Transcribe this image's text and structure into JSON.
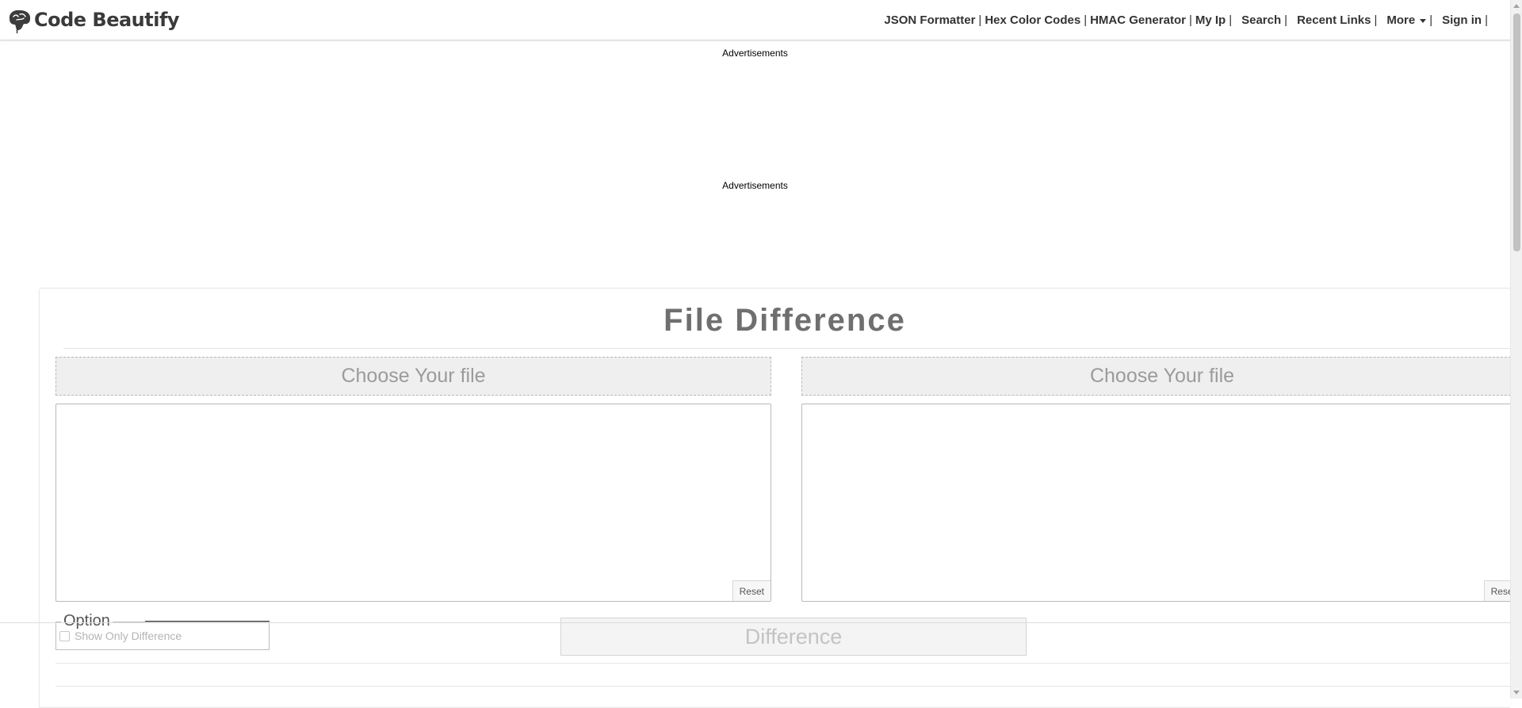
{
  "header": {
    "logo_text": "Code Beautify",
    "nav": {
      "json_formatter": "JSON Formatter",
      "hex_color_codes": "Hex Color Codes",
      "hmac_generator": "HMAC Generator",
      "my_ip": "My Ip",
      "search": "Search",
      "recent_links": "Recent Links",
      "more": "More",
      "sign_in": "Sign in"
    },
    "separator": "|"
  },
  "ads": {
    "label_1": "Advertisements",
    "label_2": "Advertisements"
  },
  "main": {
    "title": "File Difference",
    "left_choose": "Choose Your file",
    "right_choose": "Choose Your file",
    "left_reset": "Reset",
    "right_reset": "Reset",
    "option_legend": "Option",
    "show_only_difference": "Show Only Difference",
    "difference_button": "Difference"
  }
}
